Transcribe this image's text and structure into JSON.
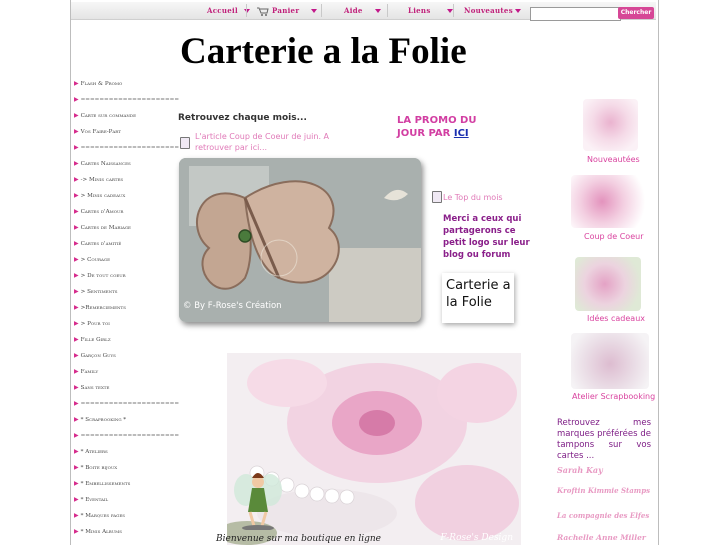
{
  "nav": {
    "items": [
      "Accueil",
      "Panier",
      "Aide",
      "Liens",
      "Nouveautes"
    ],
    "search_placeholder": "",
    "search_button": "Chercher"
  },
  "site_title": "Carterie a la Folie",
  "sidebar": {
    "items": [
      "Flash & Promo",
      "=====================",
      "Carte sur commande",
      "Vos Faire-Part",
      "=====================",
      "Cartes Naissances",
      "-> Minis cartes",
      "> Minis cadeaux",
      "Cartes d'Amour",
      "Cartes de Mariage",
      "Cartes d'amitié",
      "> Courage",
      "> De tout coeur",
      "> Sentiments",
      ">Remerciements",
      "> Pour toi",
      "Fille Girlz",
      "Garçon Guys",
      "Family",
      "Sans texte",
      "=====================",
      "* Scrapbooking *",
      "=====================",
      "* Ateliers",
      "* Boite bijoux",
      "* Embellissements",
      "* Eventail",
      "* Marques pages",
      "* Minis Albums"
    ]
  },
  "main": {
    "retrouvez": "Retrouvez chaque mois...",
    "article_link": "L'article Coup de Coeur de juin. A retrouver par ici...",
    "photo_caption": "© By F-Rose's Création",
    "promo_line": "LA PROMO DU JOUR PAR",
    "promo_link": "ICI",
    "top_mois": "Le Top du mois",
    "merci": "Merci a ceux qui partagerons ce petit logo sur leur blog ou forum",
    "logo_text": "Carterie a la Folie",
    "bienvenue": "Bienvenue sur ma boutique en ligne",
    "big_photo_watermark": "F-Rose's Design"
  },
  "right": {
    "thumbs": [
      "Nouveautées",
      "Coup de Coeur",
      "Idées cadeaux",
      "Atelier Scrapbooking"
    ],
    "brands_intro": "Retrouvez mes marques préférées de tampons sur vos cartes ...",
    "brands": [
      "Sarah Kay",
      "Kroftin Kimmie Stamps",
      "La compagnie des Elfes",
      "Rachelle Anne Miller"
    ]
  },
  "colors": {
    "accent": "#d62a8c",
    "promo": "#d23ea2",
    "link": "#1a2fb0",
    "merci": "#8a1f8a"
  }
}
